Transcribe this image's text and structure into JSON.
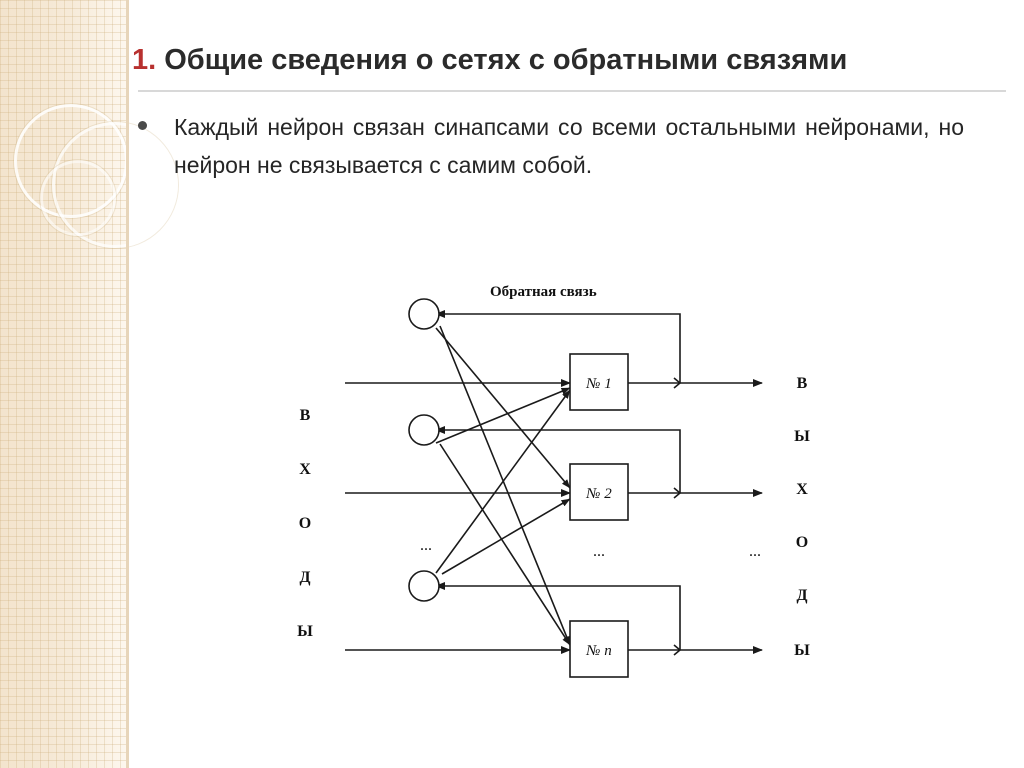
{
  "slide": {
    "title_number": "1.",
    "title_text": "Общие сведения о сетях с обратными связями",
    "bullet_text": "Каждый нейрон связан синапсами со всеми остальными нейронами, но нейрон не связывается с самим собой."
  },
  "diagram": {
    "feedback_label": "Обратная связь",
    "inputs_label_letters": [
      "В",
      "Х",
      "О",
      "Д",
      "Ы"
    ],
    "outputs_label_letters": [
      "В",
      "Ы",
      "Х",
      "О",
      "Д",
      "Ы"
    ],
    "neurons": [
      {
        "label": "№ 1"
      },
      {
        "label": "№ 2"
      },
      {
        "label": "№ n"
      }
    ],
    "ellipsis_left": "...",
    "ellipsis_center": "...",
    "ellipsis_right": "...",
    "colors": {
      "stroke": "#1a1a1a",
      "box_fill": "#ffffff",
      "accent": "#b8312f"
    }
  }
}
